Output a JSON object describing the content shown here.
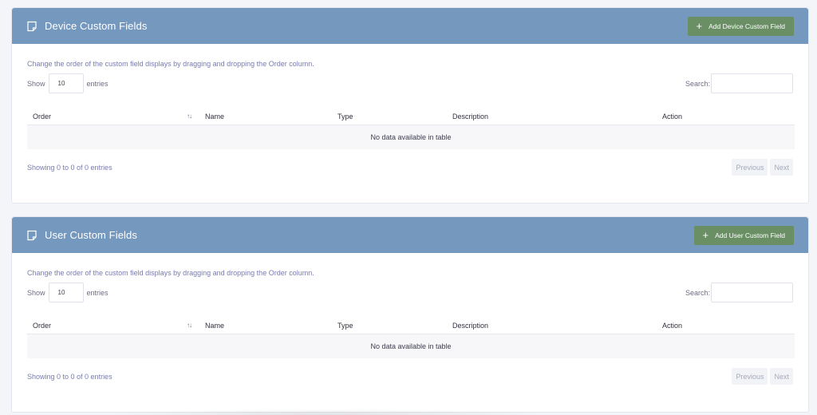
{
  "panels": [
    {
      "title": "Device Custom Fields",
      "icon": "note-icon",
      "add_button_label": "Add Device Custom Field",
      "hint": "Change the order of the custom field displays by dragging and dropping the Order column.",
      "show_label": "Show",
      "page_length": "10",
      "entries_label": "entries",
      "search_label": "Search:",
      "search_value": "",
      "columns": [
        "Order",
        "Name",
        "Type",
        "Description",
        "Action"
      ],
      "sort_indicator": "↑↓",
      "empty_message": "No data available in table",
      "info": "Showing 0 to 0 of 0 entries",
      "pager": {
        "previous": "Previous",
        "next": "Next"
      }
    },
    {
      "title": "User Custom Fields",
      "icon": "note-icon",
      "add_button_label": "Add User Custom Field",
      "hint": "Change the order of the custom field displays by dragging and dropping the Order column.",
      "show_label": "Show",
      "page_length": "10",
      "entries_label": "entries",
      "search_label": "Search:",
      "search_value": "",
      "columns": [
        "Order",
        "Name",
        "Type",
        "Description",
        "Action"
      ],
      "sort_indicator": "↑↓",
      "empty_message": "No data available in table",
      "info": "Showing 0 to 0 of 0 entries",
      "pager": {
        "previous": "Previous",
        "next": "Next"
      }
    }
  ],
  "colors": {
    "header": "#7598bf",
    "add_button": "#6a8f65",
    "hint_text": "#7a7bb0",
    "empty_row": "#f7f7fa"
  }
}
